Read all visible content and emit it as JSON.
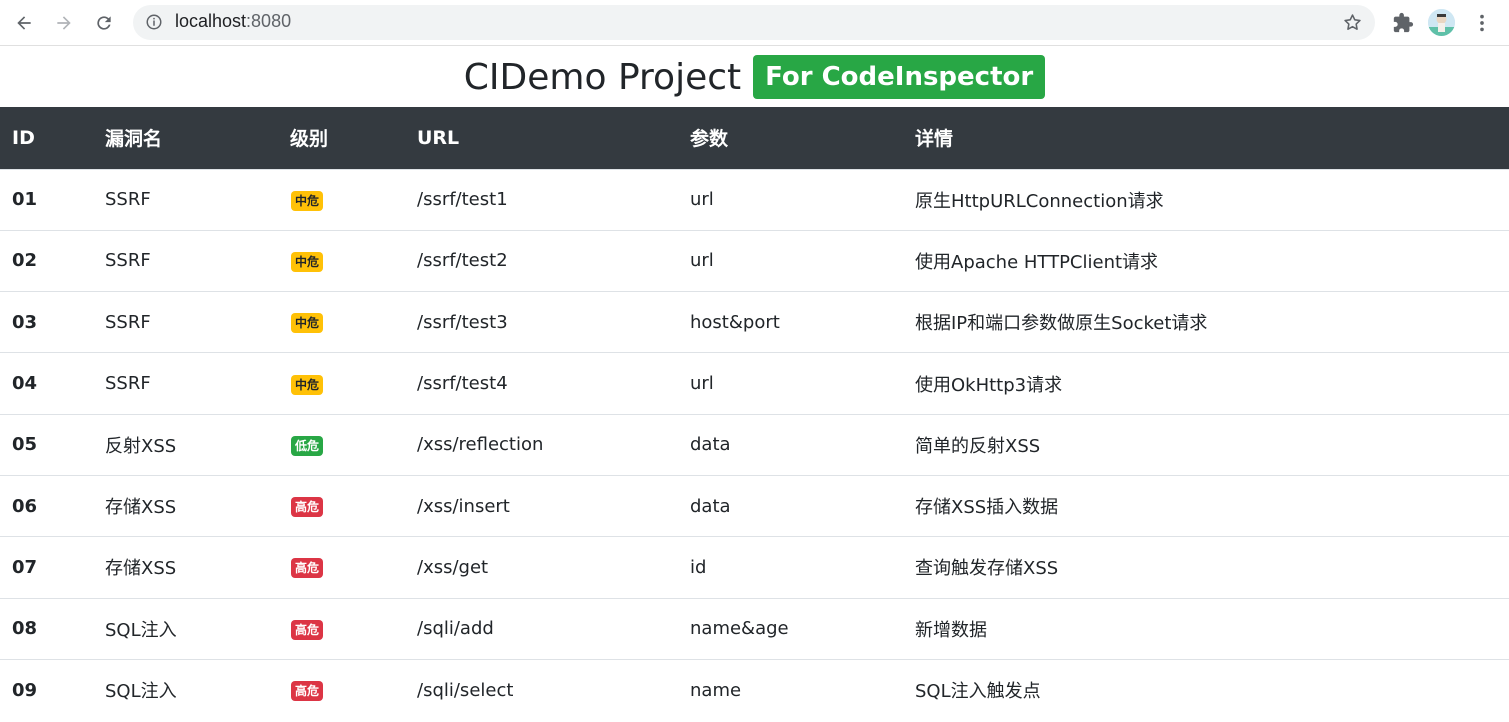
{
  "browser": {
    "url_host": "localhost",
    "url_port": ":8080"
  },
  "page": {
    "title": "CIDemo Project",
    "badge": "For CodeInspector"
  },
  "colors": {
    "header_bg": "#343a40",
    "badge_green": "#28a745",
    "level_mid": "#ffc107",
    "level_low": "#28a745",
    "level_high": "#dc3545"
  },
  "table": {
    "headers": [
      "ID",
      "漏洞名",
      "级别",
      "URL",
      "参数",
      "详情"
    ],
    "rows": [
      {
        "id": "01",
        "name": "SSRF",
        "level": "中危",
        "level_type": "mid",
        "url": "/ssrf/test1",
        "param": "url",
        "detail": "原生HttpURLConnection请求"
      },
      {
        "id": "02",
        "name": "SSRF",
        "level": "中危",
        "level_type": "mid",
        "url": "/ssrf/test2",
        "param": "url",
        "detail": "使用Apache HTTPClient请求"
      },
      {
        "id": "03",
        "name": "SSRF",
        "level": "中危",
        "level_type": "mid",
        "url": "/ssrf/test3",
        "param": "host&port",
        "detail": "根据IP和端口参数做原生Socket请求"
      },
      {
        "id": "04",
        "name": "SSRF",
        "level": "中危",
        "level_type": "mid",
        "url": "/ssrf/test4",
        "param": "url",
        "detail": "使用OkHttp3请求"
      },
      {
        "id": "05",
        "name": "反射XSS",
        "level": "低危",
        "level_type": "low",
        "url": "/xss/reflection",
        "param": "data",
        "detail": "简单的反射XSS"
      },
      {
        "id": "06",
        "name": "存储XSS",
        "level": "高危",
        "level_type": "high",
        "url": "/xss/insert",
        "param": "data",
        "detail": "存储XSS插入数据"
      },
      {
        "id": "07",
        "name": "存储XSS",
        "level": "高危",
        "level_type": "high",
        "url": "/xss/get",
        "param": "id",
        "detail": "查询触发存储XSS"
      },
      {
        "id": "08",
        "name": "SQL注入",
        "level": "高危",
        "level_type": "high",
        "url": "/sqli/add",
        "param": "name&age",
        "detail": "新增数据"
      },
      {
        "id": "09",
        "name": "SQL注入",
        "level": "高危",
        "level_type": "high",
        "url": "/sqli/select",
        "param": "name",
        "detail": "SQL注入触发点"
      }
    ]
  },
  "icons": {
    "back": "back-arrow-icon",
    "forward": "forward-arrow-icon",
    "reload": "reload-icon",
    "info": "info-icon",
    "star": "star-icon",
    "extensions": "puzzle-icon",
    "menu": "kebab-menu-icon"
  }
}
